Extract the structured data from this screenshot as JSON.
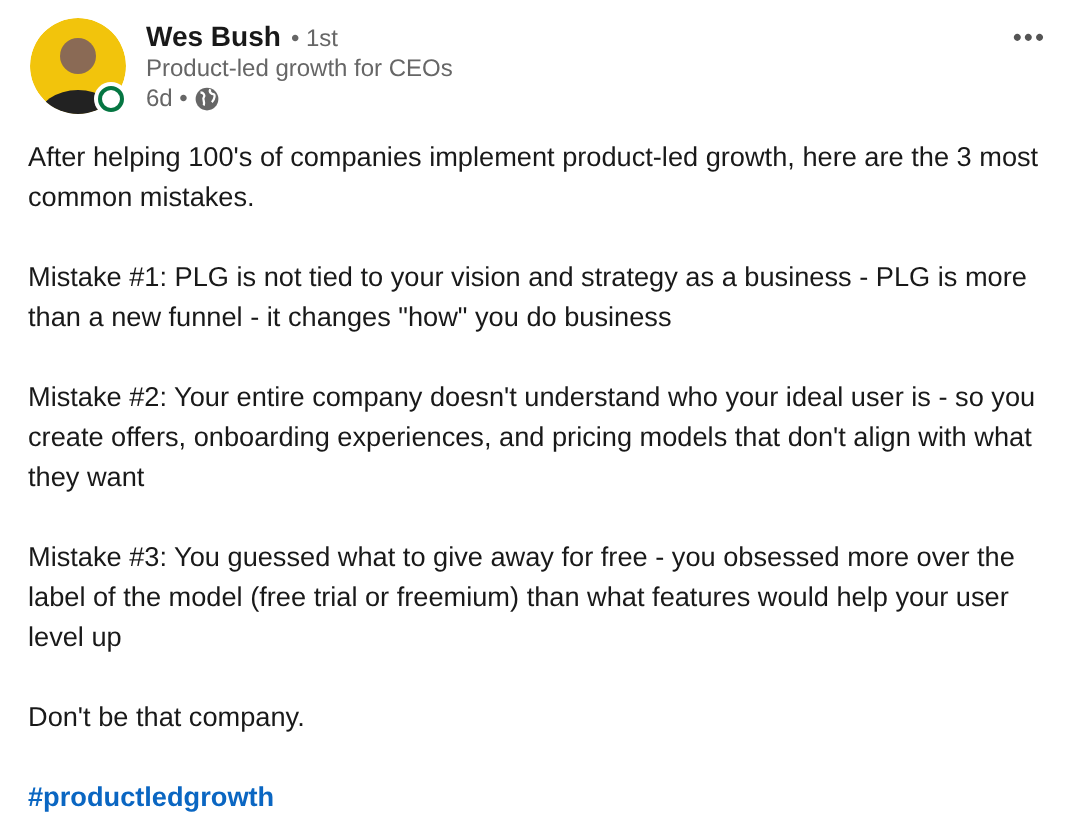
{
  "author": {
    "name": "Wes Bush",
    "degree": "• 1st",
    "headline": "Product-led growth for CEOs",
    "time": "6d •",
    "online": true
  },
  "more_button": "•••",
  "paragraphs": [
    "After helping 100's of companies implement product-led growth, here are the 3 most common mistakes.",
    "Mistake #1: PLG is not tied to your vision and strategy as a business - PLG is more than a new funnel - it changes \"how\" you do business",
    "Mistake #2: Your entire company doesn't understand who your ideal user is - so you create offers, onboarding experiences, and pricing models that don't align with what they want",
    "Mistake #3: You guessed what to give away for free - you obsessed more over the label of the model (free trial or freemium) than what features would help your user level up",
    "Don't be that company."
  ],
  "hashtag": "#productledgrowth"
}
